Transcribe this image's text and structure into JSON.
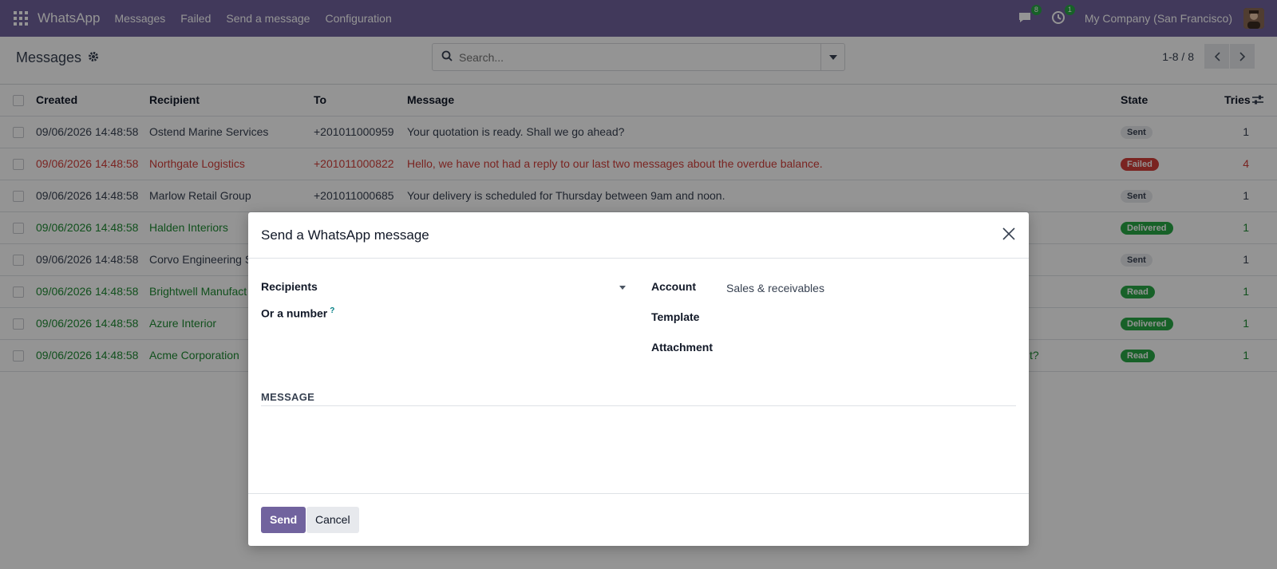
{
  "navbar": {
    "app_name": "WhatsApp",
    "menu": [
      "Messages",
      "Failed",
      "Send a message",
      "Configuration"
    ],
    "messages_count": "8",
    "activity_count": "1",
    "company": "My Company (San Francisco)"
  },
  "control": {
    "title": "Messages",
    "search_placeholder": "Search...",
    "pager": "1-8 / 8"
  },
  "list": {
    "headers": {
      "created": "Created",
      "recipient": "Recipient",
      "to": "To",
      "message": "Message",
      "state": "State",
      "tries": "Tries"
    },
    "rows": [
      {
        "created": "09/06/2026 14:48:58",
        "recipient": "Ostend Marine Services",
        "to": "+201011000959",
        "message": "Your quotation is ready. Shall we go ahead?",
        "state": "Sent",
        "tries": "1"
      },
      {
        "created": "09/06/2026 14:48:58",
        "recipient": "Northgate Logistics",
        "to": "+201011000822",
        "message": "Hello, we have not had a reply to our last two messages about the overdue balance.",
        "state": "Failed",
        "tries": "4"
      },
      {
        "created": "09/06/2026 14:48:58",
        "recipient": "Marlow Retail Group",
        "to": "+201011000685",
        "message": "Your delivery is scheduled for Thursday between 9am and noon.",
        "state": "Sent",
        "tries": "1"
      },
      {
        "created": "09/06/2026 14:48:58",
        "recipient": "Halden Interiors",
        "to": "",
        "message": "",
        "state": "Delivered",
        "tries": "1"
      },
      {
        "created": "09/06/2026 14:48:58",
        "recipient": "Corvo Engineering S",
        "to": "",
        "message": "",
        "state": "Sent",
        "tries": "1"
      },
      {
        "created": "09/06/2026 14:48:58",
        "recipient": "Brightwell Manufact",
        "to": "",
        "message": "",
        "state": "Read",
        "tries": "1"
      },
      {
        "created": "09/06/2026 14:48:58",
        "recipient": "Azure Interior",
        "to": "",
        "message": "",
        "state": "Delivered",
        "tries": "1"
      },
      {
        "created": "09/06/2026 14:48:58",
        "recipient": "Acme Corporation",
        "to": "",
        "message": "t?",
        "state": "Read",
        "tries": "1"
      }
    ]
  },
  "modal": {
    "title": "Send a WhatsApp message",
    "recipients_label": "Recipients",
    "number_label": "Or a number",
    "number_help": "?",
    "account_label": "Account",
    "account_value": "Sales & receivables",
    "template_label": "Template",
    "attachment_label": "Attachment",
    "message_section": "MESSAGE",
    "send_label": "Send",
    "cancel_label": "Cancel"
  },
  "colors": {
    "navbar": "#71639e",
    "primary": "#71639e",
    "failed": "#d23f3a",
    "success": "#28a745"
  }
}
